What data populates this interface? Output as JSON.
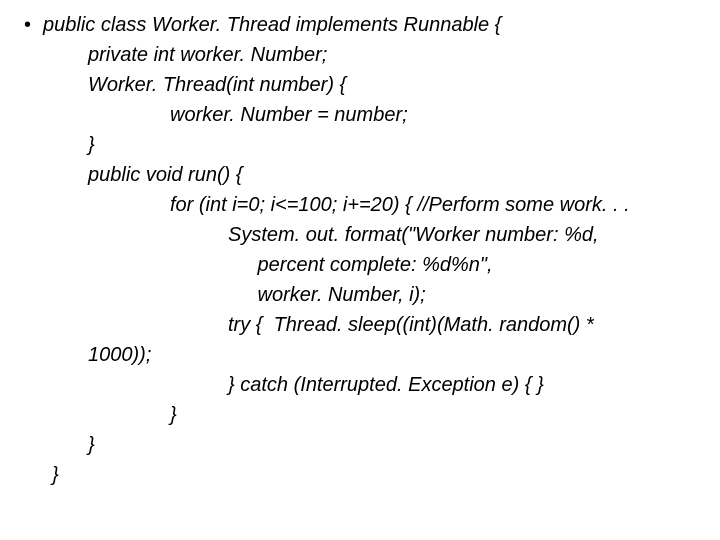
{
  "code": {
    "line1": "public class Worker. Thread implements Runnable {",
    "line2": "private int worker. Number;",
    "line3": "Worker. Thread(int number) {",
    "line4": "worker. Number = number;",
    "line5": "}",
    "line6": "public void run() {",
    "line7": "for (int i=0; i<=100; i+=20) { //Perform some work. . .",
    "line8": "System. out. format(\"Worker number: %d,",
    "line9": " percent complete: %d%n\",",
    "line10": " worker. Number, i);",
    "line11": "try {  Thread. sleep((int)(Math. random() *",
    "line12": "1000));",
    "line13": "} catch (Interrupted. Exception e) { }",
    "line14": "}",
    "line15": "}",
    "line16": "}"
  },
  "bullet": "•"
}
